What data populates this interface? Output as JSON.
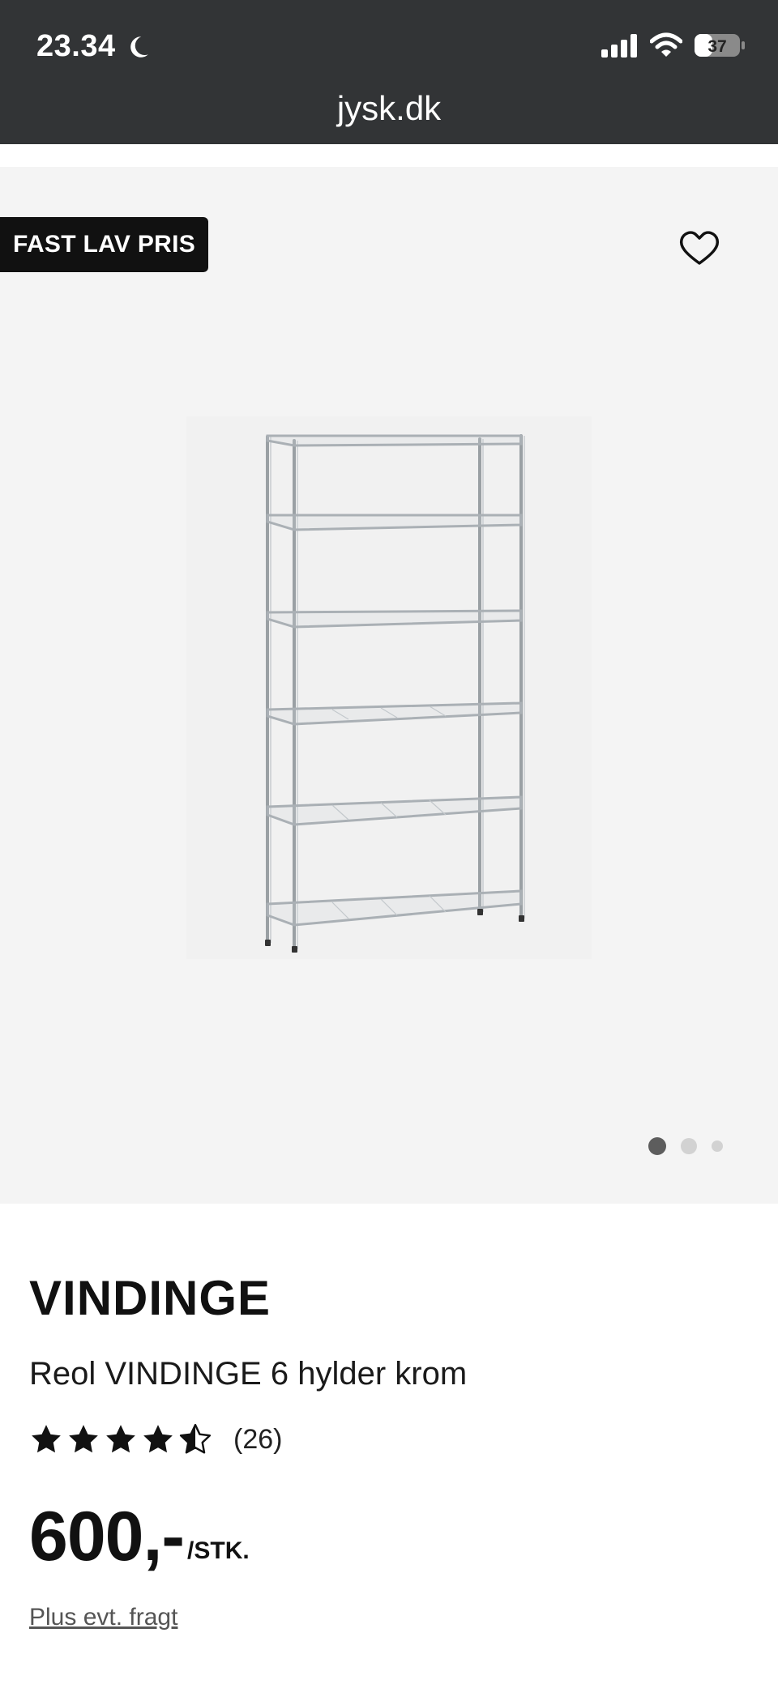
{
  "status_bar": {
    "time": "23.34",
    "battery": "37",
    "url": "jysk.dk"
  },
  "product": {
    "badge": "FAST LAV PRIS",
    "brand": "VINDINGE",
    "name": "Reol VINDINGE 6 hylder krom",
    "rating": 4.5,
    "review_count": "(26)",
    "price": "600,-",
    "price_unit": "/STK.",
    "shipping_link": "Plus evt. fragt"
  },
  "gallery": {
    "image_count": 3,
    "active_index": 0
  },
  "icons": {
    "moon": "moon-icon",
    "signal": "cellular-signal-icon",
    "wifi": "wifi-icon",
    "battery": "battery-icon",
    "favorite": "heart-icon",
    "star": "star-icon"
  },
  "colors": {
    "status_bar_bg": "#323436",
    "gallery_bg": "#f4f4f4",
    "badge_bg": "#111111",
    "dot_active": "#5d5d5d",
    "dot_inactive": "#d2d2d2"
  }
}
